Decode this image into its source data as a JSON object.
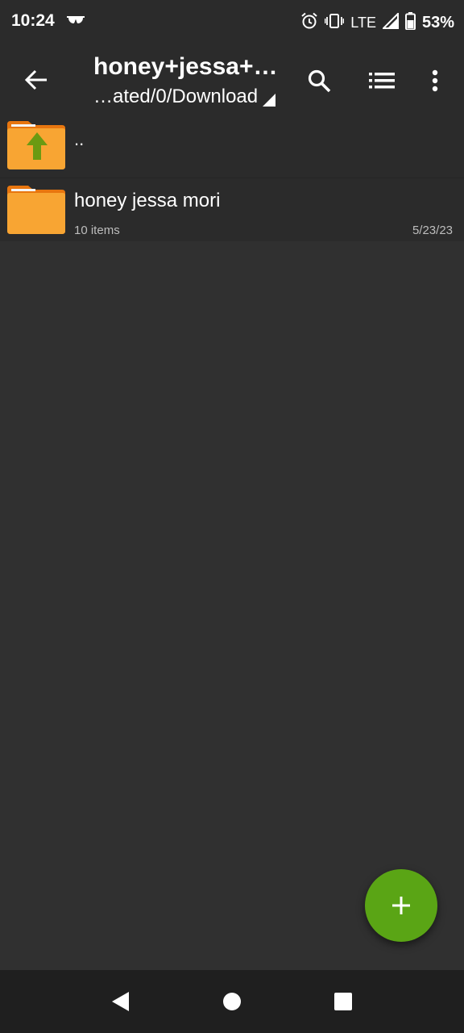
{
  "status_bar": {
    "time": "10:24",
    "network": "LTE",
    "battery": "53%"
  },
  "app_bar": {
    "title": "honey+jessa+…",
    "path": "…ated/0/Download"
  },
  "list": {
    "parent_label": "..",
    "items": [
      {
        "name": "honey jessa mori",
        "meta": "10 items",
        "date": "5/23/23"
      }
    ]
  },
  "fab": {
    "symbol": "+"
  },
  "icons": {
    "glasses": "glasses-icon",
    "alarm": "alarm-icon",
    "vibrate": "vibrate-icon",
    "signal": "signal-icon",
    "battery": "battery-icon",
    "back": "arrow-back-icon",
    "search": "search-icon",
    "list_view": "list-view-icon",
    "more": "more-vert-icon",
    "folder": "folder-icon",
    "folder_up": "folder-up-icon",
    "add": "plus-icon"
  },
  "colors": {
    "background": "#303030",
    "toolbar": "#2b2b2b",
    "folder": "#f8a533",
    "folder_tab": "#e8760f",
    "up_arrow": "#6b9a12",
    "fab": "#5aa515",
    "nav_bar": "#1f1f1f"
  }
}
